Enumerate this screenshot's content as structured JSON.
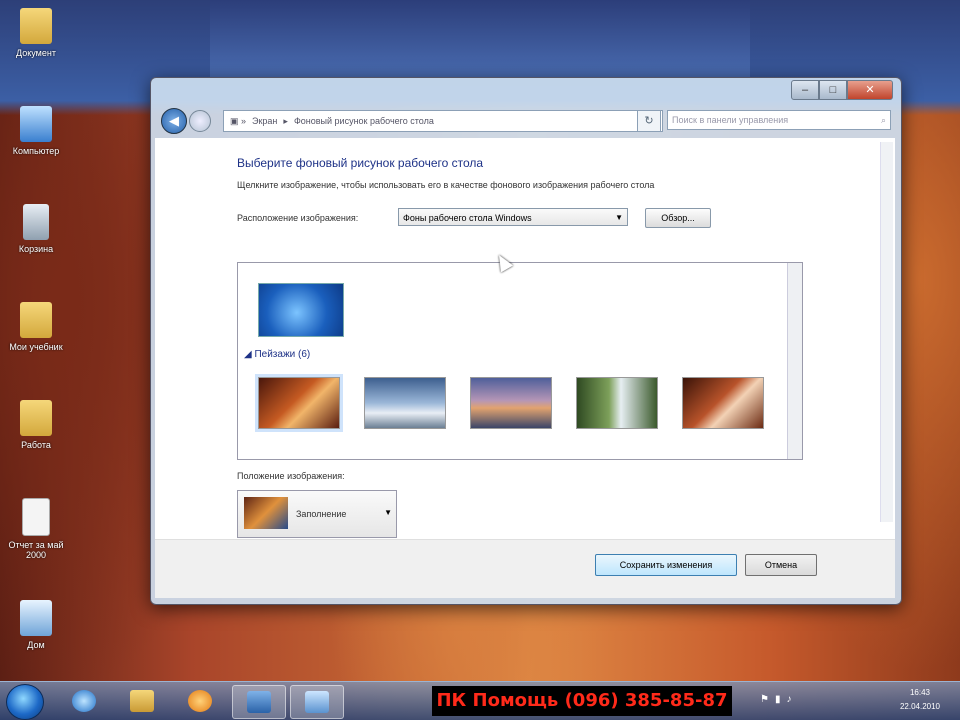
{
  "desktop": {
    "icons": [
      {
        "label": "Документ",
        "icon": "folder-icon"
      },
      {
        "label": "Компьютер",
        "icon": "computer-icon"
      },
      {
        "label": "Корзина",
        "icon": "recycle-bin-icon"
      },
      {
        "label": "Мои учебник",
        "icon": "folder-icon"
      },
      {
        "label": "Работа",
        "icon": "folder-shortcut-icon"
      },
      {
        "label": "Отчет за май 2000",
        "icon": "file-icon"
      },
      {
        "label": "Дом",
        "icon": "home-icon"
      }
    ]
  },
  "window": {
    "controls": {
      "minimize": "–",
      "maximize": "□",
      "close": "✕"
    },
    "breadcrumb": [
      "Экран",
      "Фоновый рисунок рабочего стола"
    ],
    "search_placeholder": "Поиск в панели управления",
    "heading": "Выберите фоновый рисунок рабочего стола",
    "subheading": "Щелкните изображение, чтобы использовать его в качестве фонового изображения рабочего стола",
    "location_label": "Расположение изображения:",
    "location_value": "Фоны рабочего стола Windows",
    "browse_button": "Обзор...",
    "gallery": {
      "group_label": "Пейзажи (6)",
      "thumbnails": [
        "landscape-1",
        "landscape-2",
        "landscape-3",
        "landscape-4",
        "landscape-5"
      ]
    },
    "position_label": "Положение изображения:",
    "position_value": "Заполнение",
    "save_button": "Сохранить изменения",
    "cancel_button": "Отмена"
  },
  "taskbar": {
    "banner": "ПК Помощь (096) 385-85-87",
    "tray_icons": [
      "flag-icon",
      "network-icon",
      "volume-icon"
    ],
    "time": "16:43",
    "date": "22.04.2010"
  },
  "colors": {
    "heading": "#1e3287",
    "banner_text": "#ff2a1a",
    "banner_bg": "#000000"
  }
}
